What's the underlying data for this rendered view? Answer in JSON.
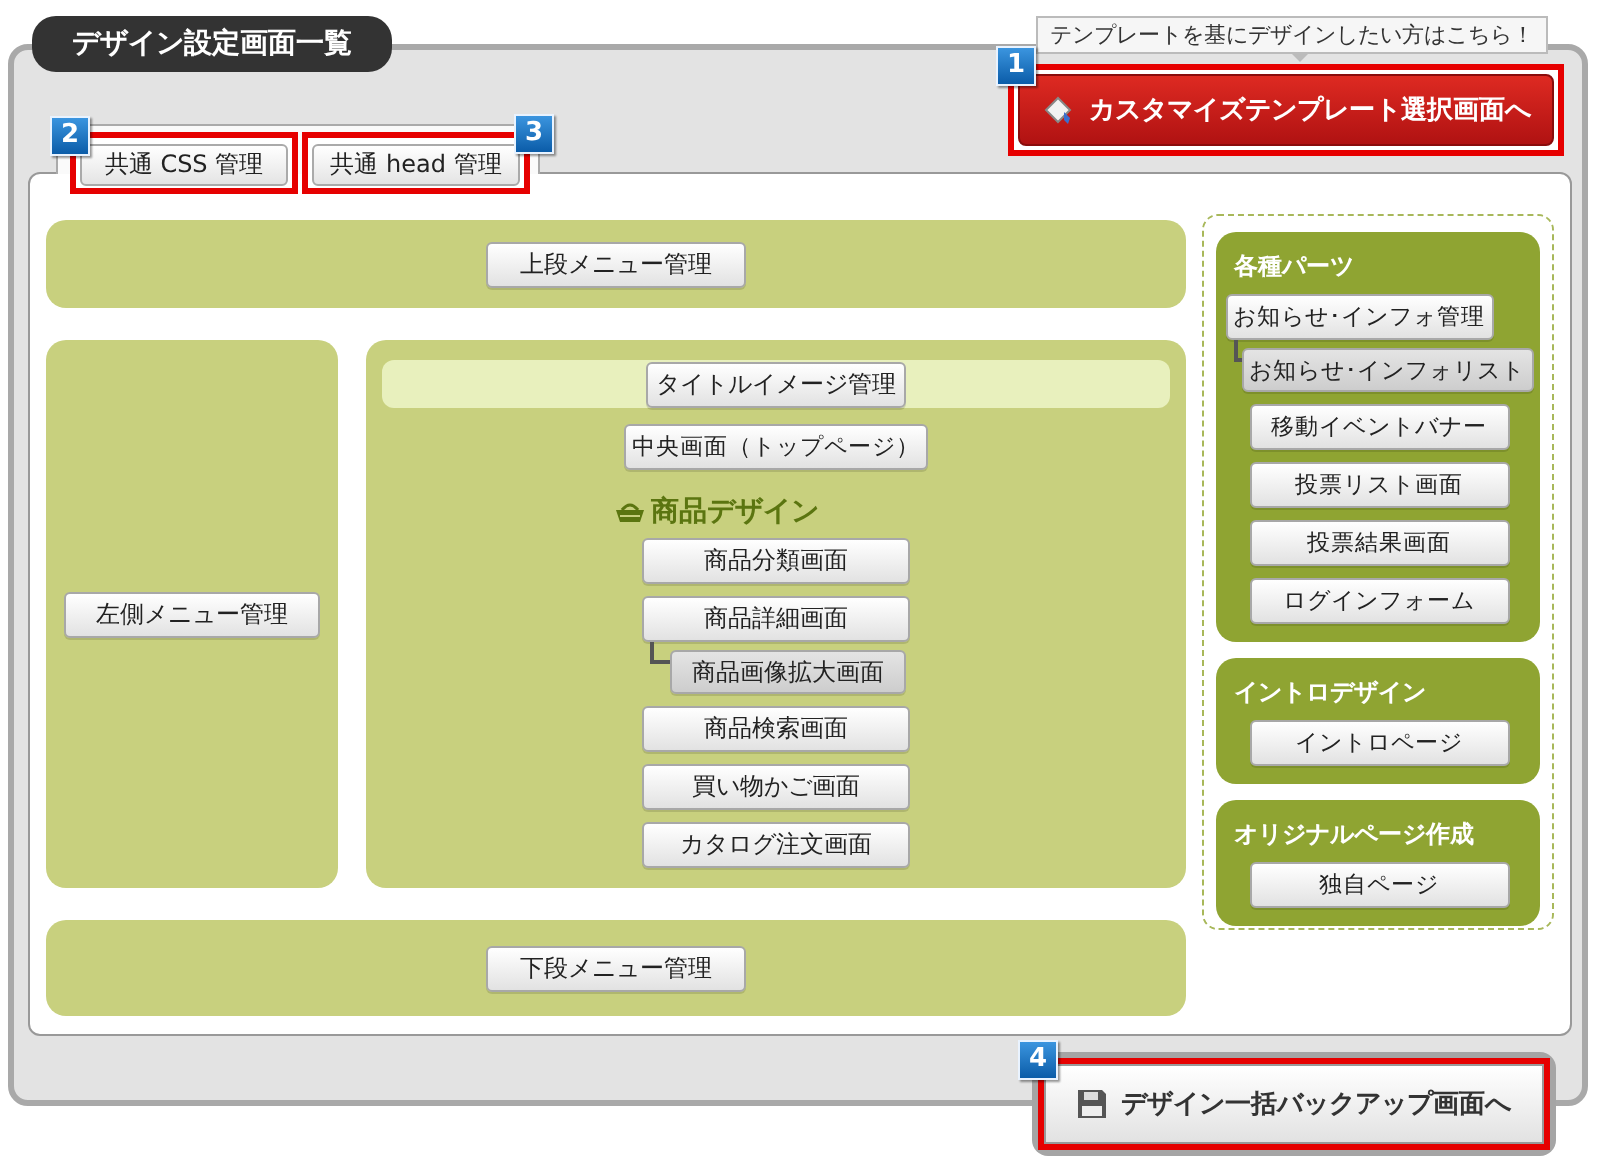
{
  "title": "デザイン設定画面一覧",
  "template_hint": "テンプレートを基にデザインしたい方はこちら！",
  "customize_button": {
    "badge": "1",
    "label": "カスタマイズテンプレート選択画面へ",
    "highlighted": true
  },
  "common_tabs": [
    {
      "badge": "2",
      "label": "共通 CSS 管理",
      "highlighted": true
    },
    {
      "badge": "3",
      "label": "共通 head 管理",
      "highlighted": true
    }
  ],
  "top_menu": "上段メニュー管理",
  "left_menu": "左側メニュー管理",
  "title_image": "タイトルイメージ管理",
  "center_screen": "中央画面（トップページ）",
  "product_design": {
    "heading": "商品デザイン",
    "items": [
      {
        "label": "商品分類画面"
      },
      {
        "label": "商品詳細画面",
        "children": [
          {
            "label": "商品画像拡大画面"
          }
        ]
      },
      {
        "label": "商品検索画面"
      },
      {
        "label": "買い物かご画面"
      },
      {
        "label": "カタログ注文画面"
      }
    ]
  },
  "bottom_menu": "下段メニュー管理",
  "side_groups": [
    {
      "heading": "各種パーツ",
      "items": [
        {
          "label": "お知らせ･インフォ管理",
          "children": [
            {
              "label": "お知らせ･インフォリスト"
            }
          ]
        },
        {
          "label": "移動イベントバナー"
        },
        {
          "label": "投票リスト画面"
        },
        {
          "label": "投票結果画面"
        },
        {
          "label": "ログインフォーム"
        }
      ]
    },
    {
      "heading": "イントロデザイン",
      "items": [
        {
          "label": "イントロページ"
        }
      ]
    },
    {
      "heading": "オリジナルページ作成",
      "items": [
        {
          "label": "独自ページ"
        }
      ]
    }
  ],
  "backup_button": {
    "badge": "4",
    "label": "デザイン一括バックアップ画面へ",
    "highlighted": true
  }
}
